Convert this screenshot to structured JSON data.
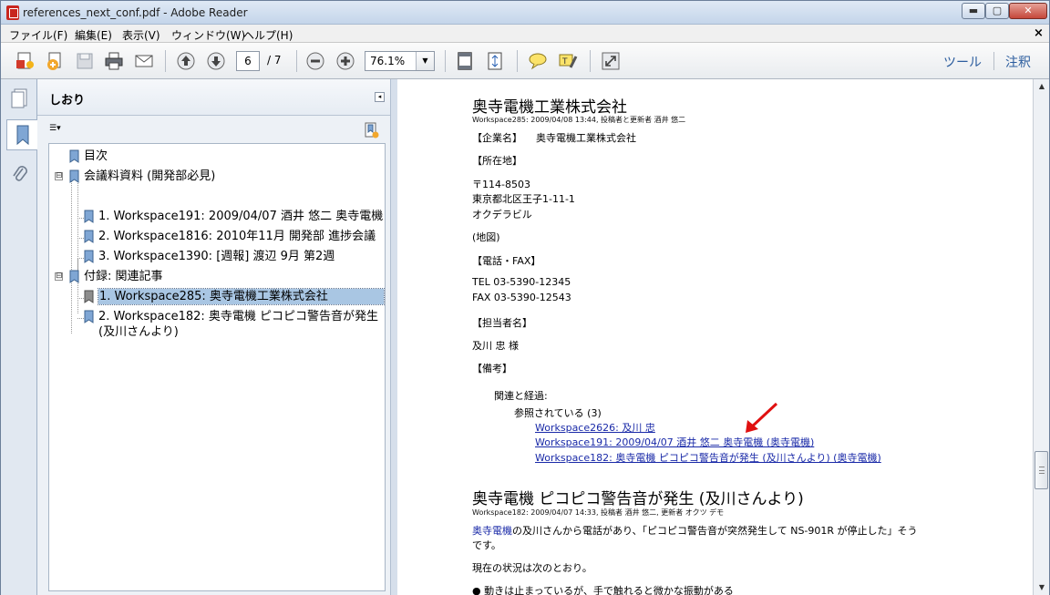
{
  "window": {
    "title": "references_next_conf.pdf - Adobe Reader",
    "min_label": "▬",
    "max_label": "▢",
    "close_label": "✕"
  },
  "menubar": {
    "items": [
      "ファイル(F)",
      "編集(E)",
      "表示(V)",
      "ウィンドウ(W)",
      "ヘルプ(H)"
    ],
    "close": "×"
  },
  "toolbar": {
    "page_current": "6",
    "page_total": "/ 7",
    "zoom": "76.1%",
    "tools_label": "ツール",
    "comment_label": "注釈"
  },
  "panel": {
    "title": "しおり",
    "collapse": "◂",
    "options": "☰▾",
    "bookmarks": [
      {
        "label": "目次",
        "level": 0
      },
      {
        "label": "会議料資料 (開発部必見)",
        "level": 0,
        "expander": "⊟"
      },
      {
        "label": "1. Workspace191: 2009/04/07 酒井 悠二 奥寺電機",
        "level": 1
      },
      {
        "label": "2. Workspace1816: 2010年11月 開発部 進捗会議",
        "level": 1
      },
      {
        "label": "3. Workspace1390: [週報] 渡辺 9月 第2週",
        "level": 1
      },
      {
        "label": "付録: 関連記事",
        "level": 0,
        "expander": "⊟"
      },
      {
        "label": "1. Workspace285: 奥寺電機工業株式会社",
        "level": 1,
        "selected": true
      },
      {
        "label": "2. Workspace182: 奥寺電機 ピコピコ警告音が発生",
        "level": 1,
        "label2": "(及川さんより)"
      }
    ]
  },
  "document": {
    "heading1": "奥寺電機工業株式会社",
    "meta1": "Workspace285: 2009/04/08 13:44, 投稿者と更新者 酒井 悠二",
    "company_label": "【企業名】",
    "company_value": "奥寺電機工業株式会社",
    "address_label": "【所在地】",
    "zip": "〒114-8503",
    "address": "東京都北区王子1-11-1",
    "building": "オクデラビル",
    "map": "(地図)",
    "phone_label": "【電話・FAX】",
    "tel": "TEL 03-5390-12345",
    "fax": "FAX 03-5390-12543",
    "person_label": "【担当者名】",
    "person": "及川 忠 様",
    "notes_label": "【備考】",
    "related": "関連と経過:",
    "referenced": "参照されている (3)",
    "links": [
      "Workspace2626: 及川 忠",
      "Workspace191: 2009/04/07 酒井 悠二 奥寺電機 (奥寺電機)",
      "Workspace182: 奥寺電機 ピコピコ警告音が発生 (及川さんより) (奥寺電機)"
    ],
    "heading2": "奥寺電機 ピコピコ警告音が発生 (及川さんより)",
    "meta2": "Workspace182: 2009/04/07 14:33, 投稿者 酒井 悠二, 更新者 オクツ デモ",
    "body_link": "奥寺電機",
    "body1": "の及川さんから電話があり、「ピコピコ警告音が突然発生して NS-901R が停止した」そう",
    "body1b": "です。",
    "body2": "現在の状況は次のとおり。",
    "bullet1": "● 動きは止まっているが、手で触れると微かな振動がある"
  },
  "colors": {
    "link": "#1a2aa8",
    "arrow": "#e01010",
    "selection": "#a9c6e3"
  }
}
